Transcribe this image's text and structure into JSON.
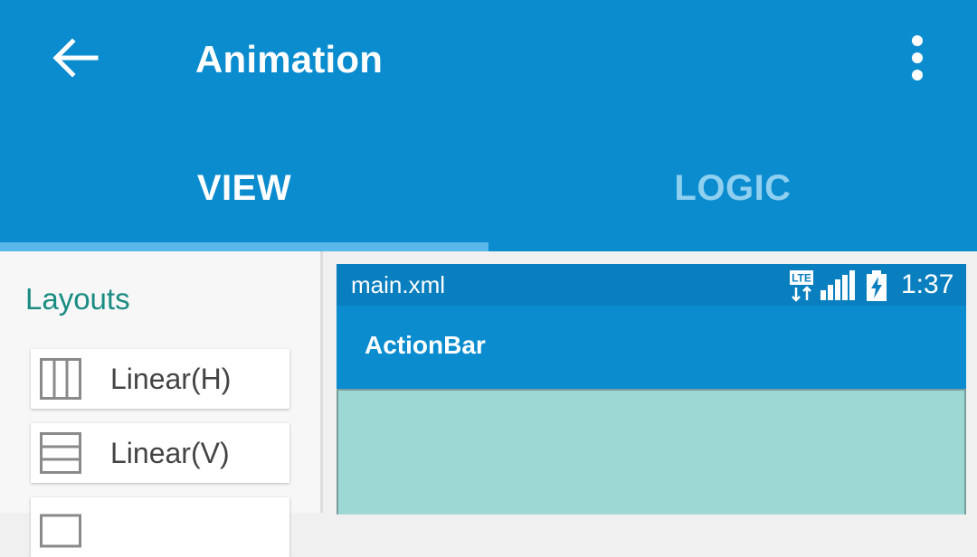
{
  "appbar": {
    "title": "Animation",
    "back_icon": "arrow-left-icon",
    "more_icon": "more-vert-icon"
  },
  "tabs": [
    {
      "label": "VIEW",
      "selected": true
    },
    {
      "label": "LOGIC",
      "selected": false
    }
  ],
  "palette": {
    "header": "Layouts",
    "items": [
      {
        "label": "Linear(H)",
        "icon": "linear-horizontal-icon"
      },
      {
        "label": "Linear(V)",
        "icon": "linear-vertical-icon"
      },
      {
        "label": "",
        "icon": "layout-icon"
      }
    ]
  },
  "preview": {
    "filename": "main.xml",
    "network": "LTE",
    "time": "1:37",
    "actionbar_title": "ActionBar"
  },
  "colors": {
    "primary": "#0a8ccf",
    "primary_dark": "#0a7fc0",
    "tab_indicator": "#5ab8ea",
    "inactive_tab": "#8fd0f0",
    "palette_header": "#1a8c82",
    "canvas": "#9ed8d4"
  }
}
